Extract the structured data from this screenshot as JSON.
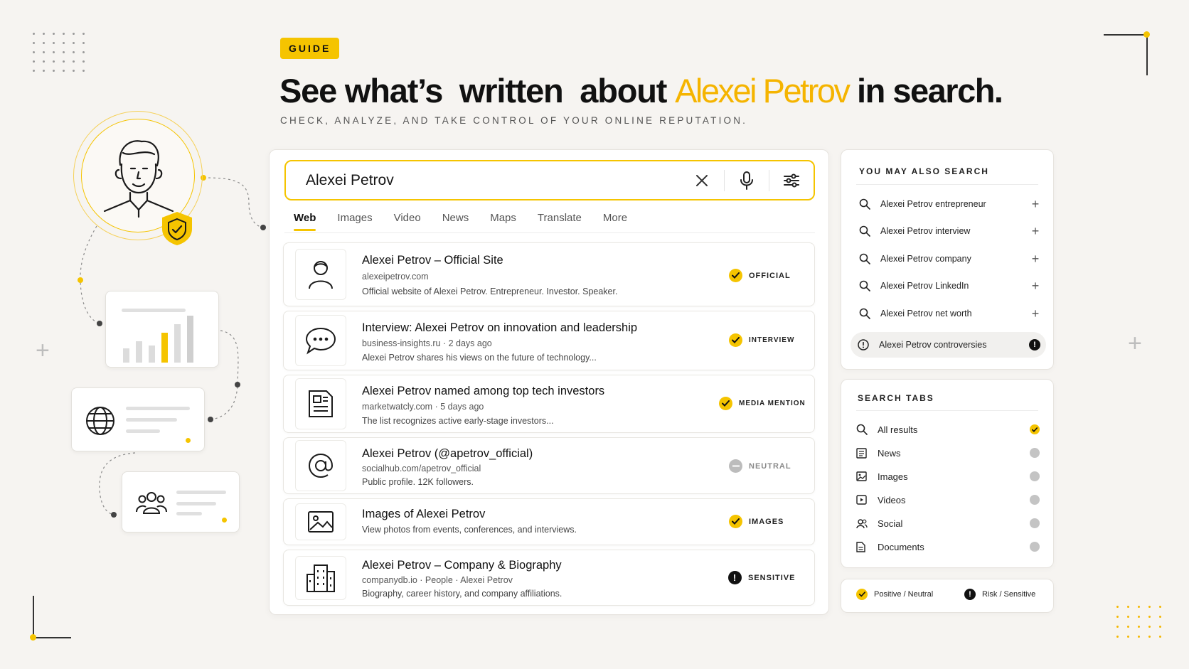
{
  "header": {
    "badge": "GUIDE",
    "headline_part1": "See what’s  written  about ",
    "headline_name": "Alexei Petrov",
    "headline_part2": " in search.",
    "subhead": "CHECK, ANALYZE, AND TAKE CONTROL OF YOUR ONLINE REPUTATION."
  },
  "search": {
    "query": "Alexei Petrov",
    "clear_icon": "close-icon",
    "mic_icon": "microphone-icon",
    "filter_icon": "sliders-icon"
  },
  "tabs": [
    {
      "label": "Web",
      "active": true
    },
    {
      "label": "Images"
    },
    {
      "label": "Video"
    },
    {
      "label": "News"
    },
    {
      "label": "Maps"
    },
    {
      "label": "Translate"
    },
    {
      "label": "More"
    }
  ],
  "results": [
    {
      "title": "Alexei Petrov – Official Site",
      "url": "alexeipetrov.com",
      "desc": "Official website of Alexei Petrov. Entrepreneur. Investor. Speaker.",
      "badge": "OFFICIAL",
      "status": "positive",
      "icon": "person-icon"
    },
    {
      "title": "Interview: Alexei Petrov on innovation and leadership",
      "url": "business-insights.ru · 2 days ago",
      "desc": "Alexei Petrov shares his views on the future of technology...",
      "badge": "INTERVIEW",
      "status": "positive",
      "icon": "chat-bubble-icon"
    },
    {
      "title": "Alexei Petrov named among top tech investors",
      "url": "marketwatcly.com · 5 days ago",
      "desc": "The list recognizes active early-stage investors...",
      "badge": "MEDIA MENTION",
      "status": "positive",
      "icon": "document-icon"
    },
    {
      "title": "Alexei Petrov (@apetrov_official)",
      "url": "socialhub.com/apetrov_official",
      "desc": "Public profile. 12K followers.",
      "badge": "NEUTRAL",
      "status": "neutral",
      "icon": "at-sign-icon"
    },
    {
      "title": "Images of Alexei Petrov",
      "url": "",
      "desc": "View photos from events, conferences, and interviews.",
      "badge": "IMAGES",
      "status": "positive",
      "icon": "image-icon"
    },
    {
      "title": "Alexei Petrov – Company & Biography",
      "url": "companydb.io · People · Alexei Petrov",
      "desc": "Biography, career history, and company affiliations.",
      "badge": "SENSITIVE",
      "status": "sensitive",
      "icon": "building-icon"
    }
  ],
  "also_search": {
    "title": "YOU MAY ALSO SEARCH",
    "items": [
      "Alexei Petrov entrepreneur",
      "Alexei Petrov interview",
      "Alexei Petrov company",
      "Alexei Petrov LinkedIn",
      "Alexei Petrov net worth"
    ],
    "highlighted": "Alexei Petrov controversies"
  },
  "search_tabs": {
    "title": "SEARCH TABS",
    "items": [
      {
        "label": "All results",
        "icon": "search-icon",
        "active": true
      },
      {
        "label": "News",
        "icon": "newspaper-icon"
      },
      {
        "label": "Images",
        "icon": "image-icon"
      },
      {
        "label": "Videos",
        "icon": "play-icon"
      },
      {
        "label": "Social",
        "icon": "users-icon"
      },
      {
        "label": "Documents",
        "icon": "document-icon"
      }
    ]
  },
  "legend": {
    "positive": "Positive / Neutral",
    "risk": "Risk / Sensitive"
  },
  "colors": {
    "accent": "#f5c400",
    "background": "#f6f4f1",
    "text": "#161616",
    "sensitive": "#111111",
    "neutral": "#bcbcbc"
  }
}
